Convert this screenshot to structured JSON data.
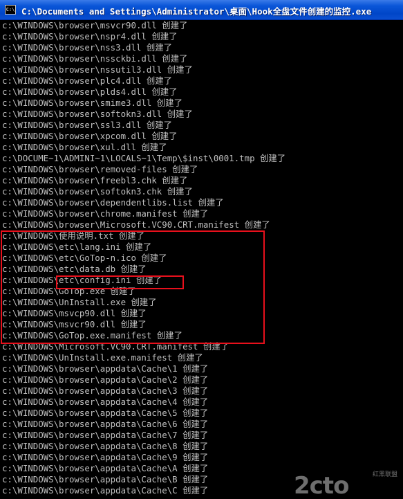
{
  "window": {
    "title": "C:\\Documents and Settings\\Administrator\\桌面\\Hook全盘文件创建的监控.exe",
    "icon_text": "C:\\"
  },
  "console": {
    "lines": [
      "c:\\WINDOWS\\browser\\msvcr90.dll 创建了",
      "c:\\WINDOWS\\browser\\nspr4.dll 创建了",
      "c:\\WINDOWS\\browser\\nss3.dll 创建了",
      "c:\\WINDOWS\\browser\\nssckbi.dll 创建了",
      "c:\\WINDOWS\\browser\\nssutil3.dll 创建了",
      "c:\\WINDOWS\\browser\\plc4.dll 创建了",
      "c:\\WINDOWS\\browser\\plds4.dll 创建了",
      "c:\\WINDOWS\\browser\\smime3.dll 创建了",
      "c:\\WINDOWS\\browser\\softokn3.dll 创建了",
      "c:\\WINDOWS\\browser\\ssl3.dll 创建了",
      "c:\\WINDOWS\\browser\\xpcom.dll 创建了",
      "c:\\WINDOWS\\browser\\xul.dll 创建了",
      "c:\\DOCUME~1\\ADMINI~1\\LOCALS~1\\Temp\\$inst\\0001.tmp 创建了",
      "c:\\WINDOWS\\browser\\removed-files 创建了",
      "c:\\WINDOWS\\browser\\freebl3.chk 创建了",
      "c:\\WINDOWS\\browser\\softokn3.chk 创建了",
      "c:\\WINDOWS\\browser\\dependentlibs.list 创建了",
      "c:\\WINDOWS\\browser\\chrome.manifest 创建了",
      "c:\\WINDOWS\\browser\\Microsoft.VC90.CRT.manifest 创建了",
      "c:\\WINDOWS\\使用说明.txt 创建了",
      "c:\\WINDOWS\\etc\\lang.ini 创建了",
      "c:\\WINDOWS\\etc\\GoTop-n.ico 创建了",
      "c:\\WINDOWS\\etc\\data.db 创建了",
      "c:\\WINDOWS\\etc\\config.ini 创建了",
      "c:\\WINDOWS\\GoTop.exe 创建了",
      "c:\\WINDOWS\\UnInstall.exe 创建了",
      "c:\\WINDOWS\\msvcp90.dll 创建了",
      "c:\\WINDOWS\\msvcr90.dll 创建了",
      "c:\\WINDOWS\\GoTop.exe.manifest 创建了",
      "c:\\WINDOWS\\Microsoft.VC90.CRT.manifest 创建了",
      "c:\\WINDOWS\\UnInstall.exe.manifest 创建了",
      "c:\\WINDOWS\\browser\\appdata\\Cache\\1 创建了",
      "c:\\WINDOWS\\browser\\appdata\\Cache\\2 创建了",
      "c:\\WINDOWS\\browser\\appdata\\Cache\\3 创建了",
      "c:\\WINDOWS\\browser\\appdata\\Cache\\4 创建了",
      "c:\\WINDOWS\\browser\\appdata\\Cache\\5 创建了",
      "c:\\WINDOWS\\browser\\appdata\\Cache\\6 创建了",
      "c:\\WINDOWS\\browser\\appdata\\Cache\\7 创建了",
      "c:\\WINDOWS\\browser\\appdata\\Cache\\8 创建了",
      "c:\\WINDOWS\\browser\\appdata\\Cache\\9 创建了",
      "c:\\WINDOWS\\browser\\appdata\\Cache\\A 创建了",
      "c:\\WINDOWS\\browser\\appdata\\Cache\\B 创建了",
      "c:\\WINDOWS\\browser\\appdata\\Cache\\C 创建了"
    ]
  },
  "watermark": {
    "main": "2cto",
    "sub": "红黑联盟"
  },
  "colors": {
    "console_bg": "#000000",
    "console_text": "#c0c0c0",
    "titlebar": "#0a56d8",
    "highlight": "#e8101c"
  }
}
